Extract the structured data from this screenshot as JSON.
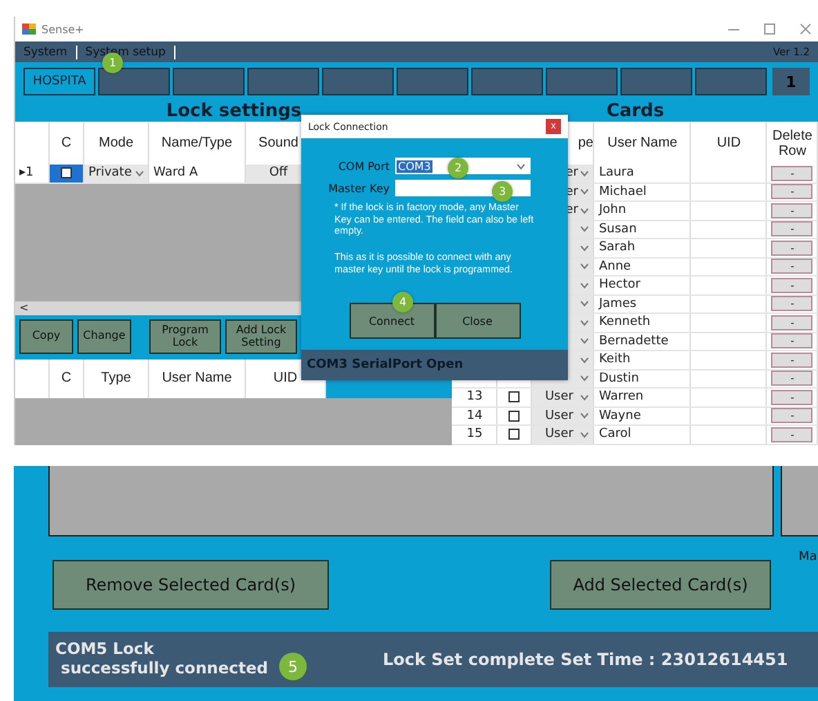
{
  "top_window": {
    "title": "Sense+",
    "menu": [
      "System",
      "System setup"
    ],
    "version": "Ver 1.2",
    "tabs": [
      {
        "label": "HOSPITA",
        "selected": true
      },
      {
        "selected": false
      },
      {
        "selected": false
      },
      {
        "selected": false
      },
      {
        "selected": false
      },
      {
        "selected": false
      },
      {
        "selected": false
      },
      {
        "selected": false
      },
      {
        "selected": false
      },
      {
        "selected": false
      }
    ],
    "page_number": "1",
    "lock_settings": {
      "title": "Lock settings",
      "columns": [
        "C",
        "Mode",
        "Name/Type",
        "Sound"
      ],
      "rows": [
        {
          "marker": "▸1",
          "checked": false,
          "mode": "Private",
          "name": "Ward A",
          "sound": "Off"
        }
      ],
      "scroll_left": "<",
      "buttons": [
        "Copy",
        "Change",
        "Program Lock",
        "Add Lock Setting"
      ],
      "user_columns": [
        "C",
        "Type",
        "User Name",
        "UID"
      ]
    },
    "cards": {
      "title": "Cards",
      "columns": [
        "pe",
        "User Name",
        "UID",
        "Delete Row"
      ],
      "rows": [
        {
          "type": "er",
          "name": "Laura",
          "delete": "-"
        },
        {
          "type": "er",
          "name": "Michael",
          "delete": "-"
        },
        {
          "type": "er",
          "name": "John",
          "delete": "-"
        },
        {
          "name": "Susan",
          "delete": "-"
        },
        {
          "name": "Sarah",
          "delete": "-"
        },
        {
          "name": "Anne",
          "delete": "-"
        },
        {
          "name": "Hector",
          "delete": "-"
        },
        {
          "name": "James",
          "delete": "-"
        },
        {
          "name": "Kenneth",
          "delete": "-"
        },
        {
          "name": "Bernadette",
          "delete": "-"
        },
        {
          "name": "Keith",
          "delete": "-"
        },
        {
          "name": "Dustin",
          "delete": "-"
        },
        {
          "number": "13",
          "type": "User",
          "checked": false,
          "name": "Warren",
          "delete": "-"
        },
        {
          "number": "14",
          "type": "User",
          "checked": false,
          "name": "Wayne",
          "delete": "-"
        },
        {
          "number": "15",
          "type": "User",
          "checked": false,
          "name": "Carol",
          "delete": "-"
        }
      ]
    },
    "dialog": {
      "title": "Lock Connection",
      "close": "x",
      "com_port_label": "COM Port",
      "com_port_value": "COM3",
      "master_key_label": "Master Key",
      "note": "* If the lock is in factory mode, any Master Key can be entered. The field can also be left empty.",
      "note_2": "This as it is possible to connect with any master key until the lock is programmed.",
      "buttons": [
        "Connect",
        "Close"
      ],
      "status": "COM3 SerialPort Open"
    },
    "callouts": [
      "1",
      "2",
      "3",
      "4"
    ]
  },
  "bottom_window": {
    "buttons": [
      "Remove Selected Card(s)",
      "Add Selected Card(s)"
    ],
    "side_label": "Ma",
    "status_left": "COM5 Lock",
    "status_left_2": "successfully connected",
    "callout": "5",
    "status_right": "Lock Set complete Set Time : 23012614451"
  }
}
